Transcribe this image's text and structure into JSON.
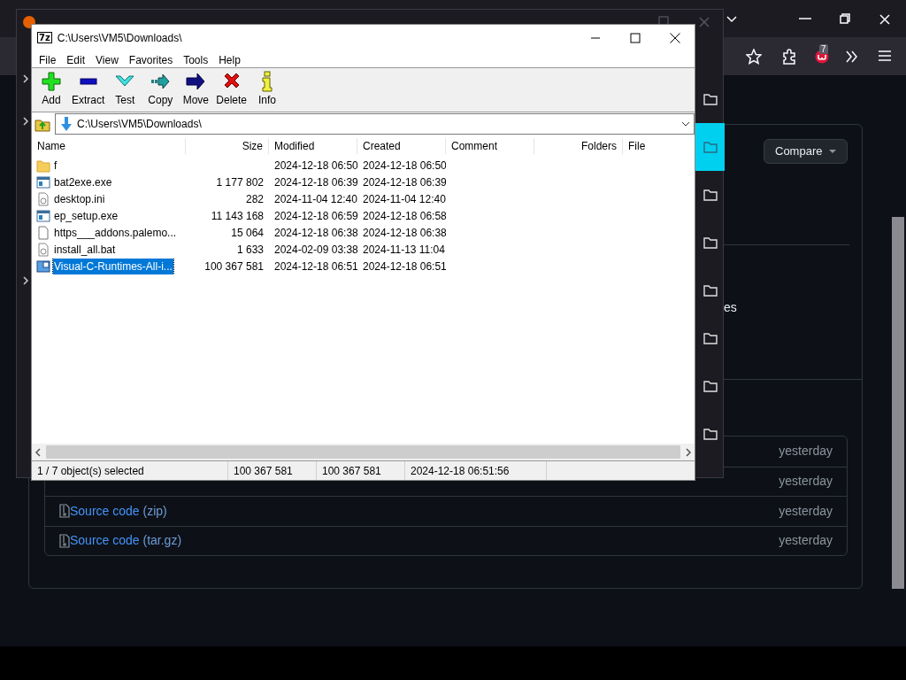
{
  "browser": {
    "toolbar": {
      "badge": "7"
    },
    "page": {
      "compare_button": "Compare",
      "text_fragment": "es",
      "assets": [
        {
          "date": "yesterday"
        },
        {
          "date": "yesterday"
        },
        {
          "name": "Source code",
          "suffix": "(zip)",
          "date": "yesterday"
        },
        {
          "name": "Source code",
          "suffix": "(tar.gz)",
          "date": "yesterday"
        }
      ]
    }
  },
  "library_window": {
    "rows": [
      {
        "selected": false
      },
      {
        "selected": true
      },
      {
        "selected": false
      },
      {
        "selected": false
      },
      {
        "selected": false
      },
      {
        "selected": false
      },
      {
        "selected": false
      },
      {
        "selected": false
      }
    ]
  },
  "archiver_window": {
    "logo": "7z",
    "title": "C:\\Users\\VM5\\Downloads\\",
    "menu": [
      "File",
      "Edit",
      "View",
      "Favorites",
      "Tools",
      "Help"
    ],
    "toolbar": [
      {
        "kind": "add",
        "label": "Add"
      },
      {
        "kind": "extract",
        "label": "Extract"
      },
      {
        "kind": "test",
        "label": "Test"
      },
      {
        "kind": "copy",
        "label": "Copy"
      },
      {
        "kind": "move",
        "label": "Move"
      },
      {
        "kind": "delete",
        "label": "Delete"
      },
      {
        "kind": "info",
        "label": "Info"
      }
    ],
    "address": "C:\\Users\\VM5\\Downloads\\",
    "columns": [
      "Name",
      "Size",
      "Modified",
      "Created",
      "Comment",
      "Folders",
      "File"
    ],
    "rows": [
      {
        "kind": "folder",
        "name": "f",
        "size": "",
        "modified": "2024-12-18 06:50",
        "created": "2024-12-18 06:50",
        "selected": false
      },
      {
        "kind": "exe",
        "name": "bat2exe.exe",
        "size": "1 177 802",
        "modified": "2024-12-18 06:39",
        "created": "2024-12-18 06:39",
        "selected": false
      },
      {
        "kind": "settings",
        "name": "desktop.ini",
        "size": "282",
        "modified": "2024-11-04 12:40",
        "created": "2024-11-04 12:40",
        "selected": false
      },
      {
        "kind": "exe",
        "name": "ep_setup.exe",
        "size": "11 143 168",
        "modified": "2024-12-18 06:59",
        "created": "2024-12-18 06:58",
        "selected": false
      },
      {
        "kind": "blank",
        "name": "https___addons.palemo...",
        "size": "15 064",
        "modified": "2024-12-18 06:38",
        "created": "2024-12-18 06:38",
        "selected": false
      },
      {
        "kind": "settings",
        "name": "install_all.bat",
        "size": "1 633",
        "modified": "2024-02-09 03:38",
        "created": "2024-11-13 11:04",
        "selected": false
      },
      {
        "kind": "installer",
        "name": "Visual-C-Runtimes-All-i...",
        "size": "100 367 581",
        "modified": "2024-12-18 06:51",
        "created": "2024-12-18 06:51",
        "selected": true
      }
    ],
    "status": [
      "1 / 7 object(s) selected",
      "100 367 581",
      "100 367 581",
      "2024-12-18 06:51:56"
    ]
  }
}
